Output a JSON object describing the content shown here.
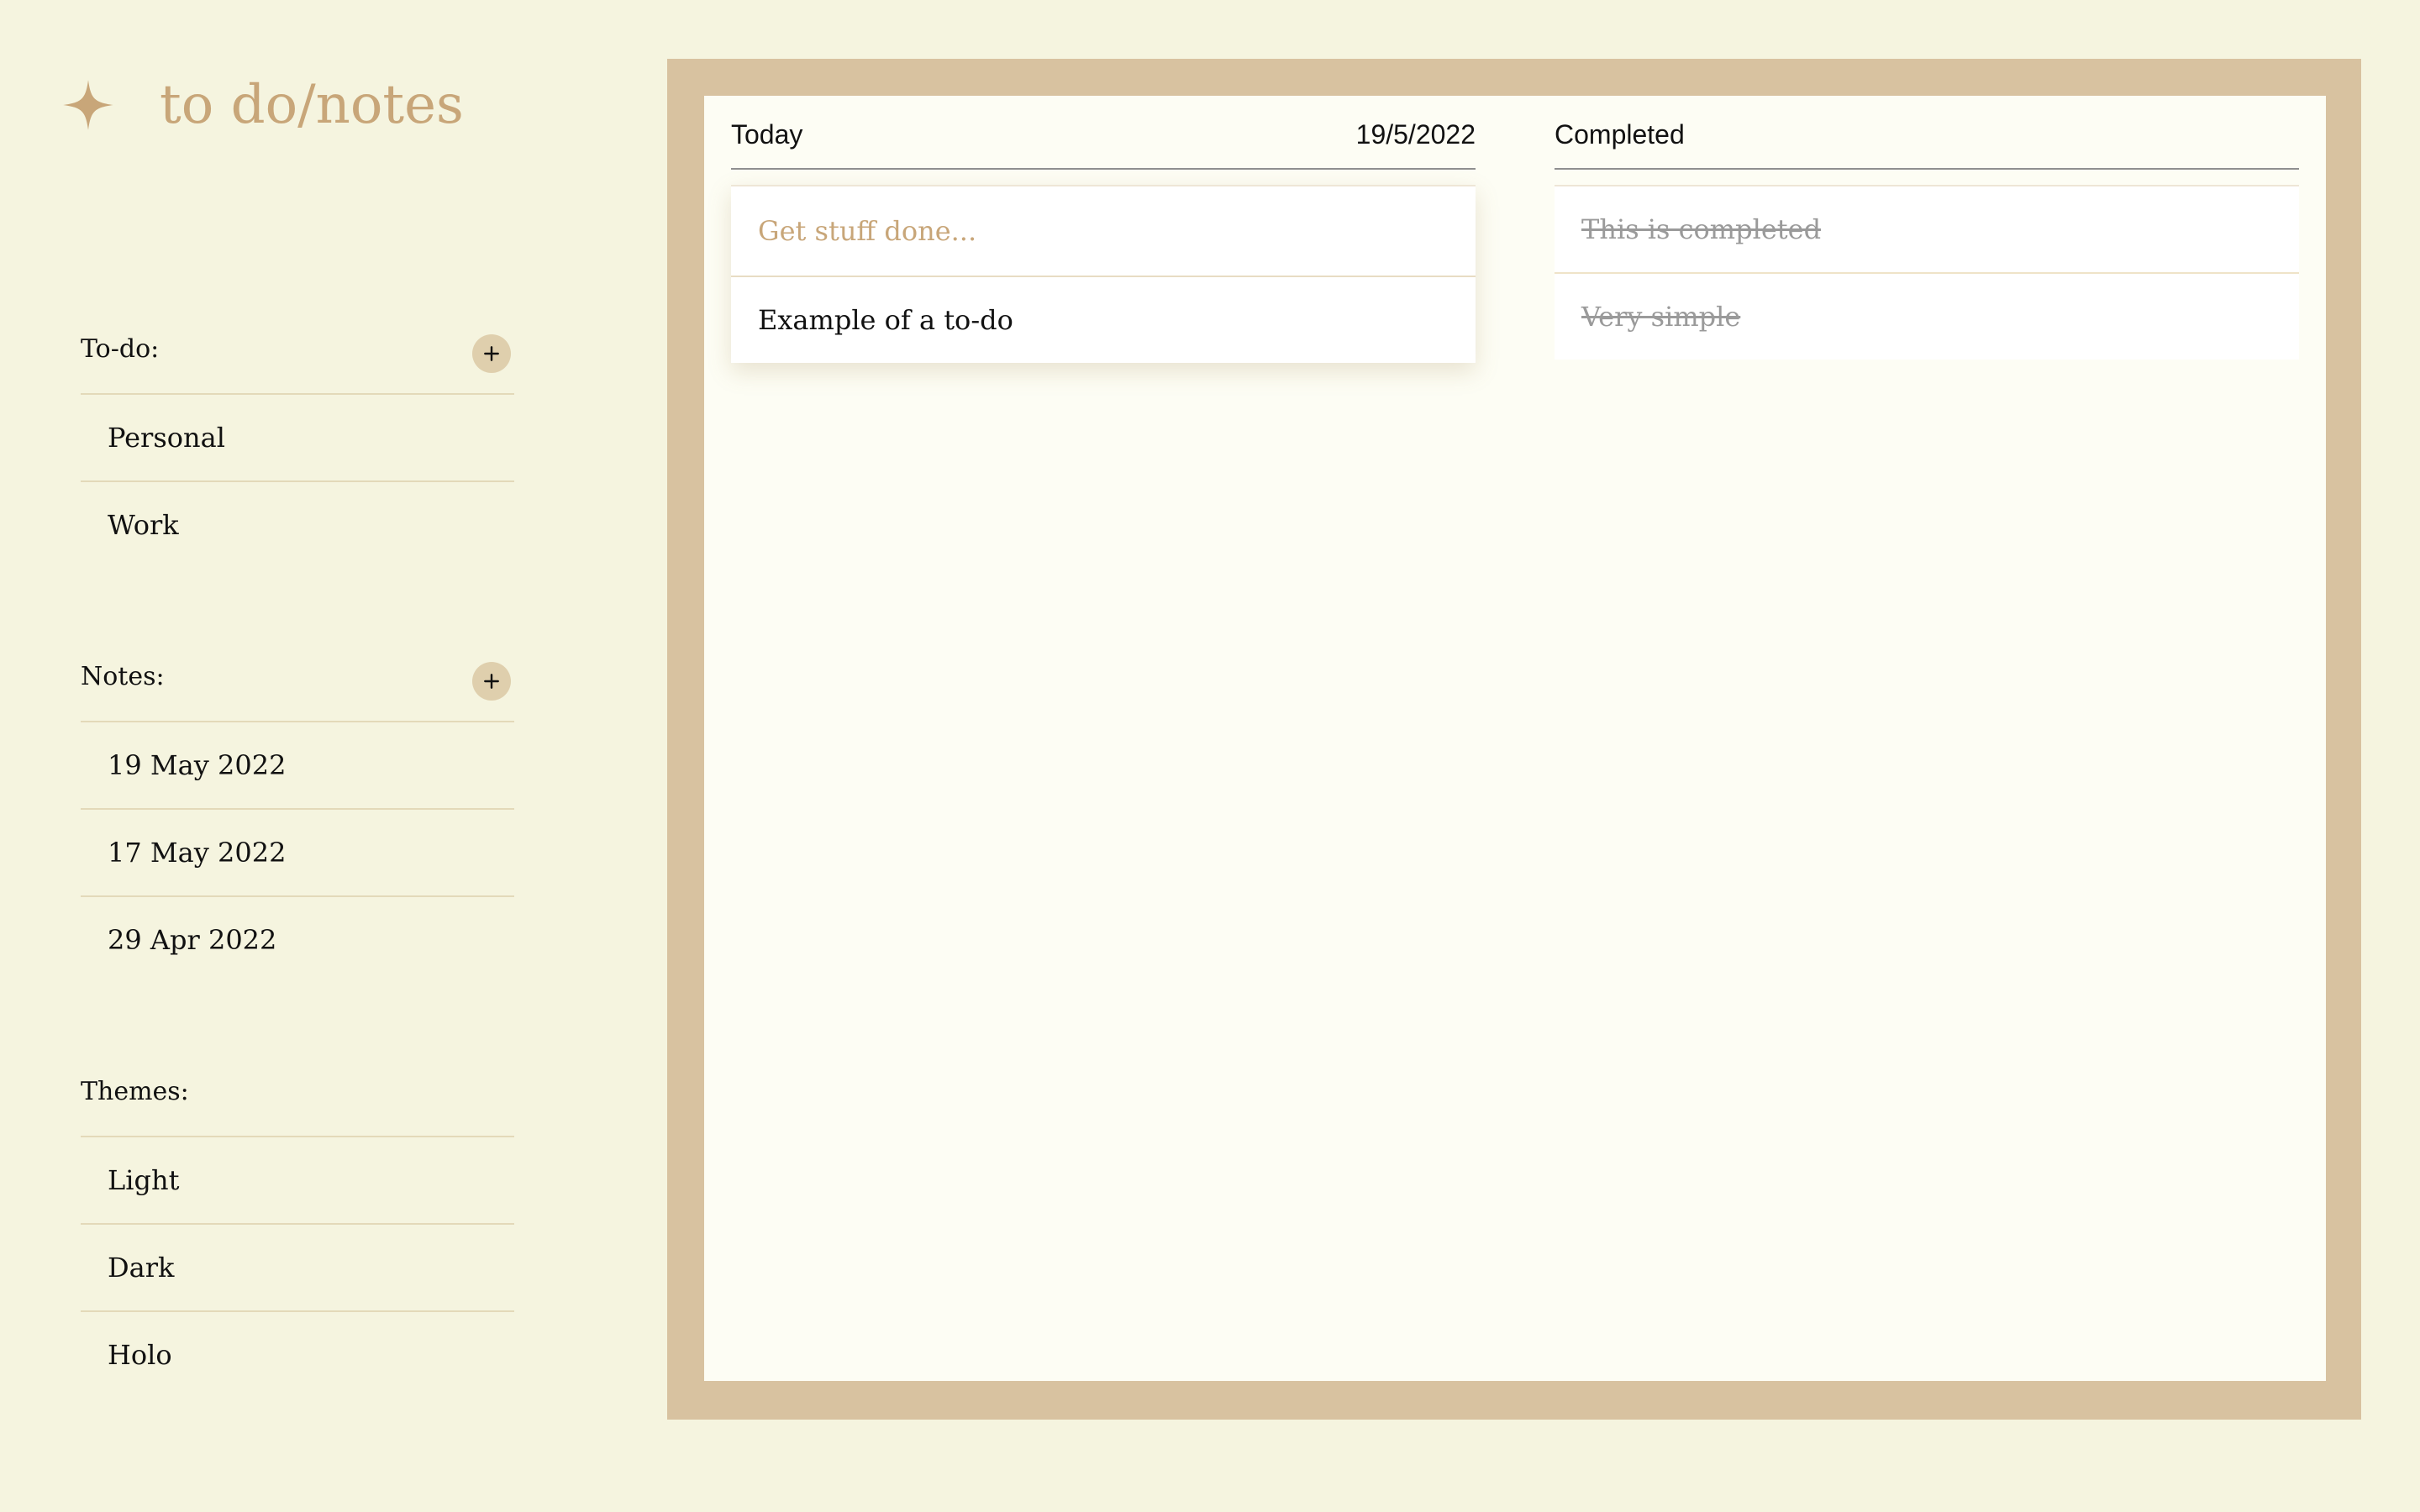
{
  "app": {
    "title": "to do/notes"
  },
  "colors": {
    "background": "#f5f4df",
    "accent": "#c8a679",
    "board_frame": "#d8c2a0",
    "add_button": "#dfcfad"
  },
  "icons": {
    "brand": "four-point-star-icon",
    "add": "plus-icon"
  },
  "sidebar": {
    "todo": {
      "label": "To-do:",
      "items": [
        "Personal",
        "Work"
      ]
    },
    "notes": {
      "label": "Notes:",
      "items": [
        "19 May 2022",
        "17 May 2022",
        "29 Apr 2022"
      ]
    },
    "themes": {
      "label": "Themes:",
      "items": [
        "Light",
        "Dark",
        "Holo"
      ]
    }
  },
  "today": {
    "title": "Today",
    "date": "19/5/2022",
    "input_placeholder": "Get stuff done...",
    "items": [
      "Example of a to-do"
    ]
  },
  "completed": {
    "title": "Completed",
    "items": [
      "This is completed",
      "Very simple"
    ]
  }
}
